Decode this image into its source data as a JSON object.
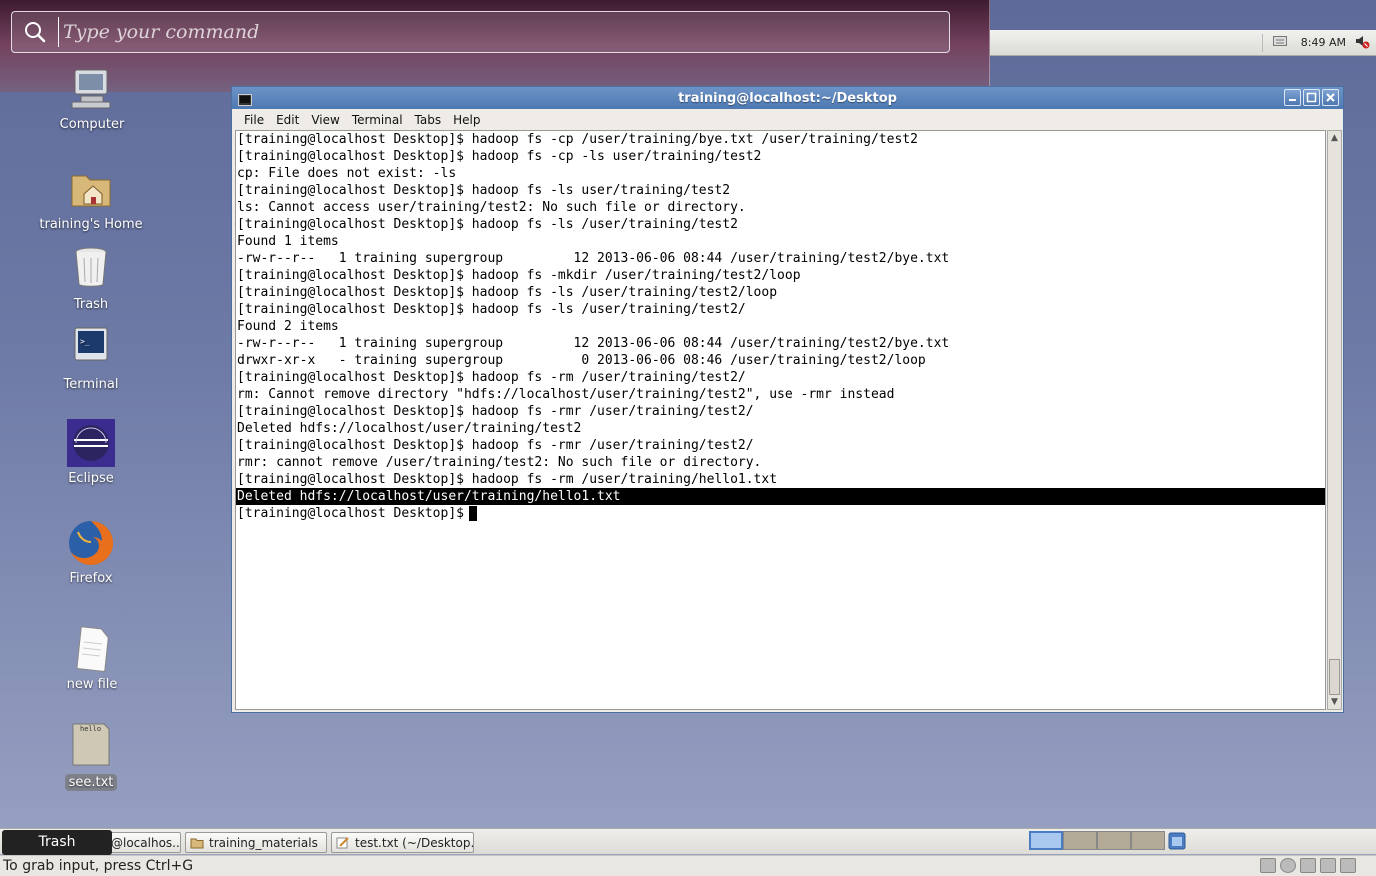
{
  "command_bar": {
    "placeholder": "Type your command"
  },
  "top_panel": {
    "clock": "8:49 AM"
  },
  "desktop_icons": [
    {
      "label": "Computer"
    },
    {
      "label": "training's Home"
    },
    {
      "label": "Trash"
    },
    {
      "label": "Terminal"
    },
    {
      "label": "Eclipse"
    },
    {
      "label": "Firefox"
    },
    {
      "label": "new file"
    },
    {
      "label": "see.txt",
      "file_preview": "hello"
    }
  ],
  "terminal": {
    "title": "training@localhost:~/Desktop",
    "menu": [
      "File",
      "Edit",
      "View",
      "Terminal",
      "Tabs",
      "Help"
    ],
    "lines": [
      "[training@localhost Desktop]$ hadoop fs -cp /user/training/bye.txt /user/training/test2",
      "[training@localhost Desktop]$ hadoop fs -cp -ls user/training/test2",
      "cp: File does not exist: -ls",
      "[training@localhost Desktop]$ hadoop fs -ls user/training/test2",
      "ls: Cannot access user/training/test2: No such file or directory.",
      "[training@localhost Desktop]$ hadoop fs -ls /user/training/test2",
      "Found 1 items",
      "-rw-r--r--   1 training supergroup         12 2013-06-06 08:44 /user/training/test2/bye.txt",
      "[training@localhost Desktop]$ hadoop fs -mkdir /user/training/test2/loop",
      "[training@localhost Desktop]$ hadoop fs -ls /user/training/test2/loop",
      "[training@localhost Desktop]$ hadoop fs -ls /user/training/test2/",
      "Found 2 items",
      "-rw-r--r--   1 training supergroup         12 2013-06-06 08:44 /user/training/test2/bye.txt",
      "drwxr-xr-x   - training supergroup          0 2013-06-06 08:46 /user/training/test2/loop",
      "[training@localhost Desktop]$ hadoop fs -rm /user/training/test2/",
      "rm: Cannot remove directory \"hdfs://localhost/user/training/test2\", use -rmr instead",
      "[training@localhost Desktop]$ hadoop fs -rmr /user/training/test2/",
      "Deleted hdfs://localhost/user/training/test2",
      "[training@localhost Desktop]$ hadoop fs -rmr /user/training/test2/",
      "rmr: cannot remove /user/training/test2: No such file or directory.",
      "[training@localhost Desktop]$ hadoop fs -rm /user/training/hello1.txt",
      "Deleted hdfs://localhost/user/training/hello1.txt"
    ],
    "prompt": "[training@localhost Desktop]$"
  },
  "taskbar": {
    "tooltip": "Trash",
    "tasks": [
      {
        "label": "@localhos..."
      },
      {
        "label": "training_materials"
      },
      {
        "label": "test.txt (~/Desktop..."
      }
    ]
  },
  "statusbar": {
    "text": "To grab input, press Ctrl+G"
  },
  "colors": {
    "titlebar": "#4d79b3",
    "desktop": "#6d7aa6",
    "highlight": "#000000"
  }
}
